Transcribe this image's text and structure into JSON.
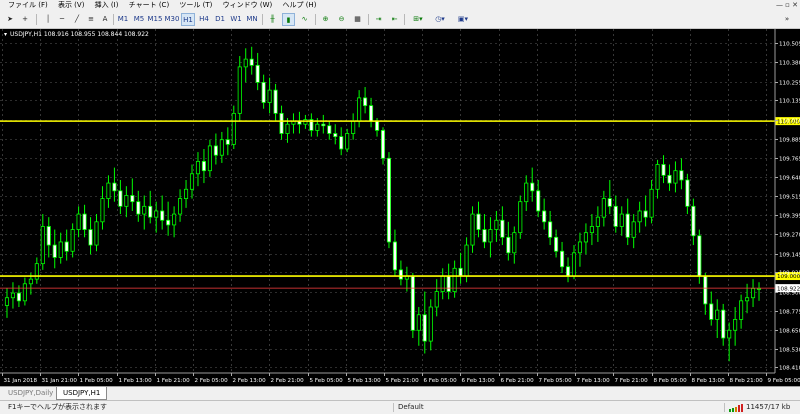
{
  "menu": {
    "items": [
      "ファイル (F)",
      "表示 (V)",
      "挿入 (I)",
      "チャート (C)",
      "ツール (T)",
      "ウィンドウ (W)",
      "ヘルプ (H)"
    ]
  },
  "toolbar": {
    "timeframes": [
      "M1",
      "M5",
      "M15",
      "M30",
      "H1",
      "H4",
      "D1",
      "W1",
      "MN"
    ],
    "active_timeframe": "H1",
    "icons": [
      "cursor-icon",
      "crosshair-icon",
      "vertical-line-icon",
      "horizontal-line-icon",
      "trendline-icon",
      "channel-icon",
      "text-icon",
      "zoom-in-icon",
      "zoom-out-icon",
      "tile-icon",
      "autoscroll-icon",
      "chart-shift-icon",
      "indicators-icon",
      "periods-icon",
      "templates-icon"
    ]
  },
  "chart": {
    "header": "USDJPY,H1  108.916 108.955 108.844 108.922",
    "background_color": "#000000",
    "bull_color": "#00ff00",
    "bear_color": "#ffffff",
    "grid_color": "#5a5a5a",
    "hline_color": "#ffff00",
    "bid_line_color": "#ff4040"
  },
  "chart_data": {
    "type": "candlestick",
    "symbol": "USDJPY",
    "timeframe": "H1",
    "last": {
      "open": 108.916,
      "high": 108.955,
      "low": 108.844,
      "close": 108.922
    },
    "ylim": [
      108.4,
      110.53
    ],
    "y_ticks": [
      "110.505",
      "110.380",
      "110.255",
      "110.135",
      "110.010",
      "109.885",
      "109.765",
      "109.640",
      "109.515",
      "109.395",
      "109.270",
      "109.145",
      "109.025",
      "108.900",
      "108.775",
      "108.650",
      "108.530",
      "108.410"
    ],
    "x_ticks": [
      "31 Jan 2018",
      "31 Jan 21:00",
      "1 Feb 05:00",
      "1 Feb 13:00",
      "1 Feb 21:00",
      "2 Feb 05:00",
      "2 Feb 13:00",
      "2 Feb 21:00",
      "5 Feb 05:00",
      "5 Feb 13:00",
      "5 Feb 21:00",
      "6 Feb 05:00",
      "6 Feb 13:00",
      "6 Feb 21:00",
      "7 Feb 05:00",
      "7 Feb 13:00",
      "7 Feb 21:00",
      "8 Feb 05:00",
      "8 Feb 13:00",
      "8 Feb 21:00",
      "9 Feb 05:00"
    ],
    "horizontal_lines": [
      {
        "price": 110.0,
        "label": "110.000",
        "color": "#ffff00"
      },
      {
        "price": 109.0,
        "label": "109.000",
        "color": "#ffff00"
      }
    ],
    "bid_line": {
      "price": 108.922,
      "label": "108.922"
    },
    "candles": [
      [
        108.81,
        108.92,
        108.73,
        108.86
      ],
      [
        108.86,
        108.96,
        108.79,
        108.89
      ],
      [
        108.89,
        108.94,
        108.8,
        108.84
      ],
      [
        108.84,
        108.99,
        108.81,
        108.95
      ],
      [
        108.95,
        109.02,
        108.88,
        108.98
      ],
      [
        108.98,
        109.12,
        108.95,
        109.08
      ],
      [
        109.08,
        109.4,
        109.04,
        109.32
      ],
      [
        109.32,
        109.38,
        109.12,
        109.2
      ],
      [
        109.2,
        109.3,
        109.05,
        109.12
      ],
      [
        109.12,
        109.28,
        109.08,
        109.22
      ],
      [
        109.22,
        109.3,
        109.1,
        109.16
      ],
      [
        109.16,
        109.34,
        109.12,
        109.3
      ],
      [
        109.3,
        109.45,
        109.25,
        109.4
      ],
      [
        109.4,
        109.46,
        109.25,
        109.3
      ],
      [
        109.3,
        109.38,
        109.14,
        109.2
      ],
      [
        109.2,
        109.4,
        109.16,
        109.35
      ],
      [
        109.35,
        109.58,
        109.3,
        109.5
      ],
      [
        109.5,
        109.65,
        109.44,
        109.6
      ],
      [
        109.6,
        109.7,
        109.48,
        109.55
      ],
      [
        109.55,
        109.62,
        109.4,
        109.45
      ],
      [
        109.45,
        109.58,
        109.38,
        109.52
      ],
      [
        109.52,
        109.63,
        109.42,
        109.48
      ],
      [
        109.48,
        109.55,
        109.35,
        109.4
      ],
      [
        109.4,
        109.52,
        109.3,
        109.45
      ],
      [
        109.45,
        109.55,
        109.34,
        109.38
      ],
      [
        109.38,
        109.48,
        109.28,
        109.42
      ],
      [
        109.42,
        109.52,
        109.3,
        109.36
      ],
      [
        109.36,
        109.48,
        109.26,
        109.33
      ],
      [
        109.33,
        109.45,
        109.25,
        109.4
      ],
      [
        109.4,
        109.56,
        109.35,
        109.5
      ],
      [
        109.5,
        109.62,
        109.44,
        109.56
      ],
      [
        109.56,
        109.72,
        109.5,
        109.66
      ],
      [
        109.66,
        109.8,
        109.58,
        109.74
      ],
      [
        109.74,
        109.82,
        109.6,
        109.68
      ],
      [
        109.68,
        109.88,
        109.64,
        109.84
      ],
      [
        109.84,
        109.92,
        109.72,
        109.78
      ],
      [
        109.78,
        109.93,
        109.73,
        109.88
      ],
      [
        109.88,
        109.96,
        109.78,
        109.85
      ],
      [
        109.85,
        110.1,
        109.82,
        110.05
      ],
      [
        110.05,
        110.42,
        110.0,
        110.35
      ],
      [
        110.35,
        110.47,
        110.25,
        110.4
      ],
      [
        110.4,
        110.48,
        110.3,
        110.36
      ],
      [
        110.36,
        110.44,
        110.2,
        110.25
      ],
      [
        110.25,
        110.3,
        110.08,
        110.12
      ],
      [
        110.12,
        110.28,
        110.05,
        110.2
      ],
      [
        110.2,
        110.24,
        110.0,
        110.05
      ],
      [
        110.05,
        110.1,
        109.88,
        109.92
      ],
      [
        109.92,
        110.02,
        109.86,
        109.98
      ],
      [
        109.98,
        110.05,
        109.92,
        110.0
      ],
      [
        110.0,
        110.06,
        109.92,
        109.98
      ],
      [
        109.98,
        110.04,
        109.95,
        110.01
      ],
      [
        110.01,
        110.05,
        109.9,
        109.94
      ],
      [
        109.94,
        110.02,
        109.9,
        109.98
      ],
      [
        109.98,
        110.04,
        109.92,
        109.97
      ],
      [
        109.97,
        110.0,
        109.88,
        109.92
      ],
      [
        109.92,
        109.98,
        109.85,
        109.9
      ],
      [
        109.9,
        109.96,
        109.78,
        109.82
      ],
      [
        109.82,
        109.95,
        109.8,
        109.92
      ],
      [
        109.92,
        110.05,
        109.88,
        110.0
      ],
      [
        110.0,
        110.2,
        109.96,
        110.15
      ],
      [
        110.15,
        110.22,
        110.05,
        110.1
      ],
      [
        110.1,
        110.15,
        109.96,
        110.0
      ],
      [
        110.0,
        110.02,
        109.9,
        109.94
      ],
      [
        109.94,
        109.96,
        109.72,
        109.76
      ],
      [
        109.76,
        109.8,
        109.18,
        109.22
      ],
      [
        109.22,
        109.3,
        109.0,
        109.04
      ],
      [
        109.04,
        109.1,
        108.94,
        108.98
      ],
      [
        108.98,
        109.06,
        108.9,
        109.0
      ],
      [
        109.0,
        109.02,
        108.6,
        108.65
      ],
      [
        108.65,
        108.8,
        108.55,
        108.75
      ],
      [
        108.75,
        108.9,
        108.5,
        108.58
      ],
      [
        108.58,
        108.85,
        108.52,
        108.8
      ],
      [
        108.8,
        108.98,
        108.74,
        108.9
      ],
      [
        108.9,
        109.05,
        108.85,
        109.0
      ],
      [
        109.0,
        109.08,
        108.85,
        108.9
      ],
      [
        108.9,
        109.1,
        108.86,
        109.05
      ],
      [
        109.05,
        109.15,
        108.95,
        109.0
      ],
      [
        109.0,
        109.25,
        108.96,
        109.2
      ],
      [
        109.2,
        109.45,
        109.15,
        109.4
      ],
      [
        109.4,
        109.48,
        109.25,
        109.3
      ],
      [
        109.3,
        109.4,
        109.18,
        109.22
      ],
      [
        109.22,
        109.38,
        109.12,
        109.3
      ],
      [
        109.3,
        109.42,
        109.22,
        109.36
      ],
      [
        109.36,
        109.45,
        109.2,
        109.25
      ],
      [
        109.25,
        109.35,
        109.1,
        109.15
      ],
      [
        109.15,
        109.32,
        109.08,
        109.28
      ],
      [
        109.28,
        109.52,
        109.24,
        109.48
      ],
      [
        109.48,
        109.65,
        109.42,
        109.6
      ],
      [
        109.6,
        109.7,
        109.48,
        109.55
      ],
      [
        109.55,
        109.62,
        109.38,
        109.42
      ],
      [
        109.42,
        109.5,
        109.3,
        109.35
      ],
      [
        109.35,
        109.42,
        109.2,
        109.25
      ],
      [
        109.25,
        109.3,
        109.12,
        109.16
      ],
      [
        109.16,
        109.22,
        109.02,
        109.06
      ],
      [
        109.06,
        109.12,
        108.96,
        109.0
      ],
      [
        109.0,
        109.2,
        108.98,
        109.15
      ],
      [
        109.15,
        109.28,
        109.06,
        109.22
      ],
      [
        109.22,
        109.34,
        109.14,
        109.28
      ],
      [
        109.28,
        109.4,
        109.2,
        109.32
      ],
      [
        109.32,
        109.45,
        109.22,
        109.38
      ],
      [
        109.38,
        109.55,
        109.32,
        109.5
      ],
      [
        109.5,
        109.62,
        109.4,
        109.45
      ],
      [
        109.45,
        109.52,
        109.28,
        109.32
      ],
      [
        109.32,
        109.45,
        109.26,
        109.4
      ],
      [
        109.4,
        109.5,
        109.2,
        109.25
      ],
      [
        109.25,
        109.4,
        109.18,
        109.35
      ],
      [
        109.35,
        109.48,
        109.28,
        109.42
      ],
      [
        109.42,
        109.52,
        109.32,
        109.38
      ],
      [
        109.38,
        109.62,
        109.34,
        109.56
      ],
      [
        109.56,
        109.75,
        109.5,
        109.72
      ],
      [
        109.72,
        109.78,
        109.6,
        109.65
      ],
      [
        109.65,
        109.72,
        109.55,
        109.6
      ],
      [
        109.6,
        109.74,
        109.54,
        109.68
      ],
      [
        109.68,
        109.76,
        109.56,
        109.62
      ],
      [
        109.62,
        109.66,
        109.4,
        109.45
      ],
      [
        109.45,
        109.5,
        109.2,
        109.26
      ],
      [
        109.26,
        109.3,
        108.95,
        109.0
      ],
      [
        109.0,
        109.02,
        108.75,
        108.82
      ],
      [
        108.82,
        108.9,
        108.68,
        108.72
      ],
      [
        108.72,
        108.85,
        108.6,
        108.78
      ],
      [
        108.78,
        108.82,
        108.55,
        108.6
      ],
      [
        108.6,
        108.7,
        108.45,
        108.65
      ],
      [
        108.65,
        108.8,
        108.55,
        108.72
      ],
      [
        108.72,
        108.88,
        108.66,
        108.84
      ],
      [
        108.84,
        108.95,
        108.76,
        108.86
      ],
      [
        108.86,
        108.98,
        108.8,
        108.92
      ],
      [
        108.92,
        108.96,
        108.84,
        108.92
      ]
    ]
  },
  "tabs": [
    "USDJPY,Daily",
    "USDJPY,H1"
  ],
  "active_tab": 1,
  "status": {
    "help": "F1キーでヘルプが表示されます",
    "profile": "Default",
    "traffic": "11457/17 kb"
  }
}
